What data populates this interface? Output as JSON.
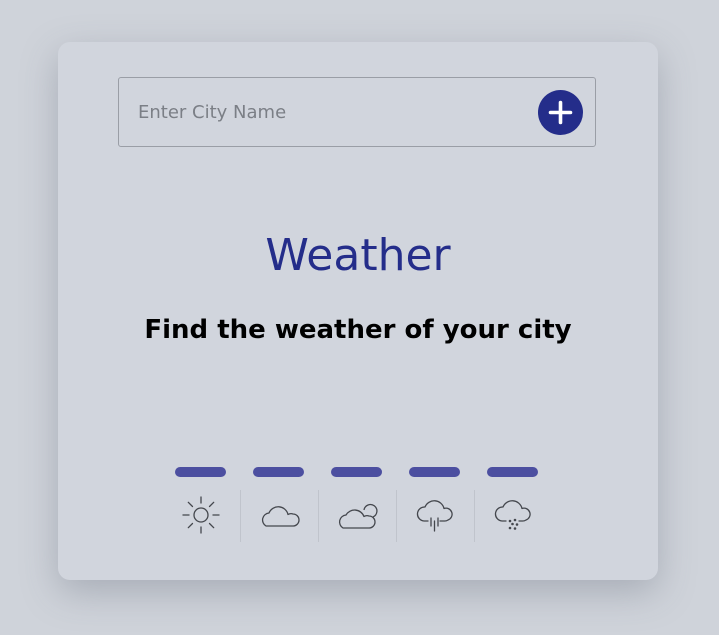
{
  "search": {
    "placeholder": "Enter City Name",
    "value": ""
  },
  "add_button": {
    "icon": "plus-icon",
    "color": "#242d8a"
  },
  "main": {
    "title": "Weather",
    "subtitle": "Find the weather of your city"
  },
  "colors": {
    "accent": "#242d8a",
    "bar": "#4c4fa0",
    "background": "#d1d5dd"
  },
  "weather_icons": [
    {
      "icon": "sun-icon"
    },
    {
      "icon": "cloud-icon"
    },
    {
      "icon": "partly-cloudy-icon"
    },
    {
      "icon": "rain-icon"
    },
    {
      "icon": "snow-icon"
    }
  ]
}
